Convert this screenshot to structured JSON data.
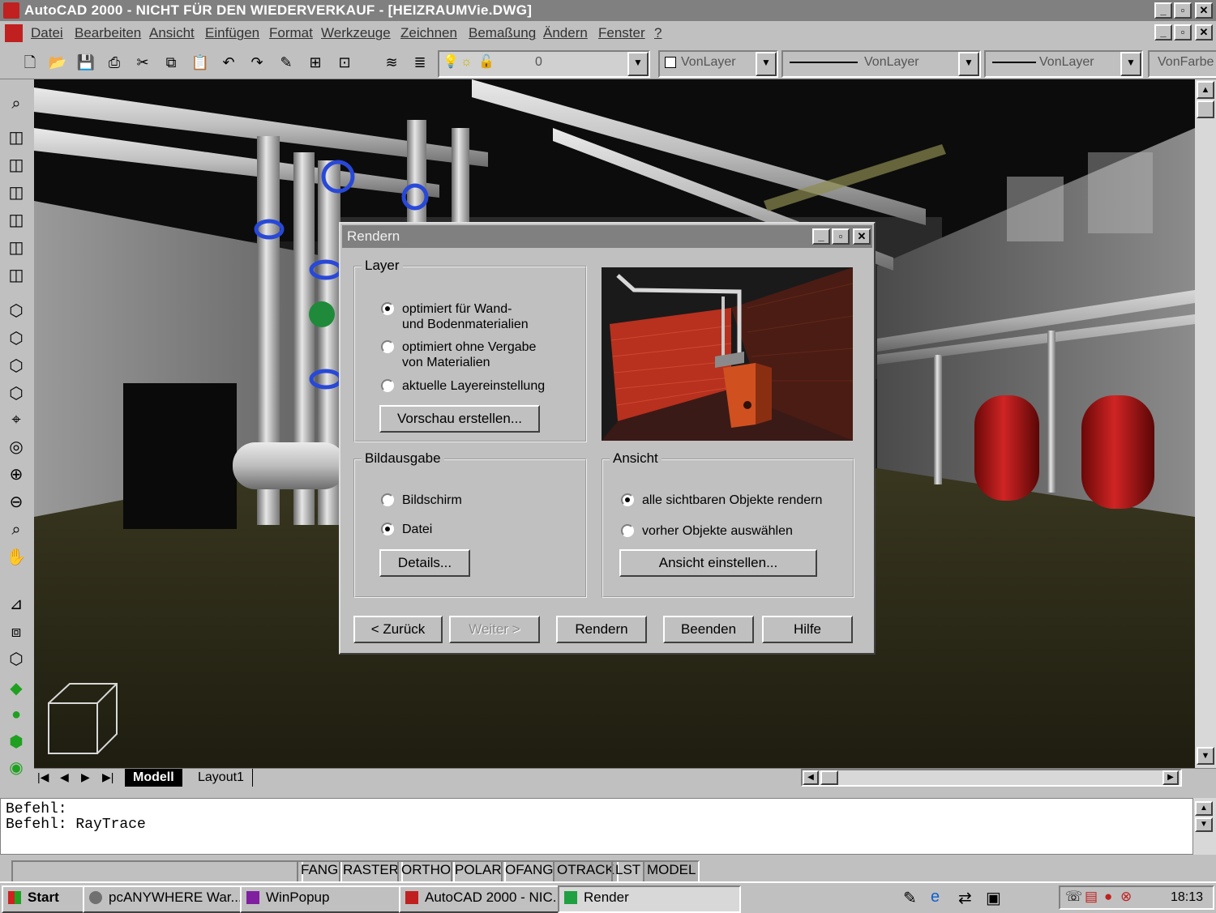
{
  "window": {
    "title": "AutoCAD 2000 - NICHT FÜR DEN WIEDERVERKAUF - [HEIZRAUMVie.DWG]",
    "min": "_",
    "max": "▫",
    "close": "✕"
  },
  "menu": [
    "Datei",
    "Bearbeiten",
    "Ansicht",
    "Einfügen",
    "Format",
    "Werkzeuge",
    "Zeichnen",
    "Bemaßung",
    "Ändern",
    "Fenster",
    "?"
  ],
  "toolbar": {
    "layer_value": "0",
    "color_value": "VonLayer",
    "linetype_value": "VonLayer",
    "lineweight_value": "VonLayer",
    "plotstyle_value": "VonFarbe"
  },
  "tabs": {
    "model": "Modell",
    "layout": "Layout1"
  },
  "command": {
    "line1": "Befehl:",
    "line2": "Befehl:  RayTrace"
  },
  "status": [
    "FANG",
    "RASTER",
    "ORTHO",
    "POLAR",
    "OFANG",
    "OTRACK",
    "LST",
    "MODEL"
  ],
  "taskbar": {
    "start": "Start",
    "tasks": [
      "pcANYWHERE War...",
      "WinPopup",
      "AutoCAD 2000 - NIC...",
      "Render"
    ],
    "clock": "18:13"
  },
  "dialog": {
    "title": "Rendern",
    "layer": {
      "label": "Layer",
      "options": [
        {
          "line1": "optimiert für Wand-",
          "line2": "und Bodenmaterialien",
          "selected": true
        },
        {
          "line1": "optimiert ohne Vergabe",
          "line2": "von Materialien",
          "selected": false
        },
        {
          "line1": "aktuelle Layereinstellung",
          "line2": "",
          "selected": false
        }
      ],
      "preview_button": "Vorschau erstellen..."
    },
    "output": {
      "label": "Bildausgabe",
      "options": [
        {
          "label": "Bildschirm",
          "selected": false
        },
        {
          "label": "Datei",
          "selected": true
        }
      ],
      "details_button": "Details..."
    },
    "view": {
      "label": "Ansicht",
      "options": [
        {
          "label": "alle sichtbaren Objekte rendern",
          "selected": true
        },
        {
          "label": "vorher Objekte auswählen",
          "selected": false
        }
      ],
      "set_view_button": "Ansicht einstellen..."
    },
    "buttons": {
      "back": "< Zurück",
      "next": "Weiter >",
      "render": "Rendern",
      "finish": "Beenden",
      "help": "Hilfe"
    }
  },
  "colors": {
    "brick": "#b83020",
    "boiler": "#d05020",
    "tank": "#b01818",
    "pipe": "#c8c8c8",
    "valve": "#2040c0"
  }
}
